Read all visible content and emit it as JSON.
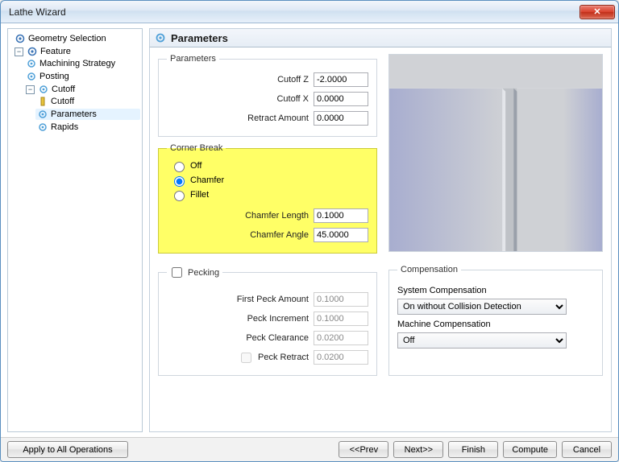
{
  "window": {
    "title": "Lathe Wizard",
    "close": "✕"
  },
  "tree": {
    "geometry_selection": "Geometry Selection",
    "feature": "Feature",
    "machining_strategy": "Machining Strategy",
    "posting": "Posting",
    "cutoff_group": "Cutoff",
    "cutoff": "Cutoff",
    "parameters": "Parameters",
    "rapids": "Rapids"
  },
  "panel": {
    "heading": "Parameters",
    "params": {
      "legend": "Parameters",
      "cutoff_z_label": "Cutoff Z",
      "cutoff_z": "-2.0000",
      "cutoff_x_label": "Cutoff X",
      "cutoff_x": "0.0000",
      "retract_label": "Retract Amount",
      "retract": "0.0000"
    },
    "corner": {
      "legend": "Corner Break",
      "off": "Off",
      "chamfer": "Chamfer",
      "fillet": "Fillet",
      "length_label": "Chamfer Length",
      "length": "0.1000",
      "angle_label": "Chamfer Angle",
      "angle": "45.0000"
    },
    "pecking": {
      "legend": "Pecking",
      "first_label": "First Peck Amount",
      "first": "0.1000",
      "incr_label": "Peck Increment",
      "incr": "0.1000",
      "clr_label": "Peck Clearance",
      "clr": "0.0200",
      "retract_label": "Peck Retract",
      "retract": "0.0200"
    },
    "comp": {
      "legend": "Compensation",
      "sys_label": "System Compensation",
      "sys_value": "On without Collision Detection",
      "mach_label": "Machine Compensation",
      "mach_value": "Off"
    }
  },
  "footer": {
    "apply_all": "Apply to All Operations",
    "prev": "<<Prev",
    "next": "Next>>",
    "finish": "Finish",
    "compute": "Compute",
    "cancel": "Cancel"
  }
}
